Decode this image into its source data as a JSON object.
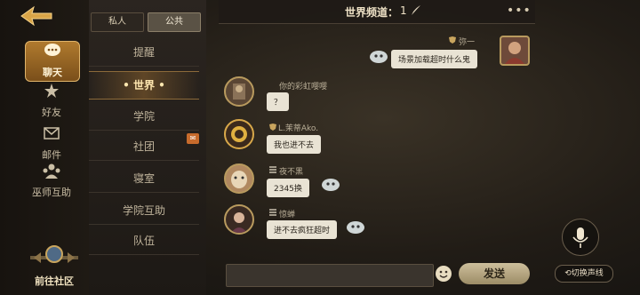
{
  "nav": {
    "items": [
      {
        "label": "聊天"
      },
      {
        "label": "好友"
      },
      {
        "label": "邮件"
      },
      {
        "label": "巫师互助"
      }
    ],
    "community_label": "前往社区"
  },
  "tabs": {
    "private": "私人",
    "public": "公共"
  },
  "channels": [
    {
      "label": "提醒"
    },
    {
      "label": "• 世界 •"
    },
    {
      "label": "学院"
    },
    {
      "label": "社团"
    },
    {
      "label": "寝室"
    },
    {
      "label": "学院互助"
    },
    {
      "label": "队伍"
    }
  ],
  "header": {
    "title": "世界频道：",
    "count": "1",
    "more": "•••"
  },
  "messages": [
    {
      "side": "right",
      "name": "弥一",
      "text": "场景加载超时什么鬼"
    },
    {
      "side": "left",
      "name": "你的彩虹嘤嘤",
      "text": "？"
    },
    {
      "side": "left",
      "name": "L.茉蒂Ako.",
      "text": "我也进不去"
    },
    {
      "side": "left",
      "name": "夜不黑",
      "text": "2345换"
    },
    {
      "side": "left",
      "name": "惊蝉",
      "text": "进不去疯狂超时"
    }
  ],
  "input": {
    "placeholder": "",
    "send_label": "发送",
    "switch_label": "切换声线"
  },
  "colors": {
    "accent": "#b07a2e",
    "bubble": "#e9e3d4",
    "gold": "#e0b46a"
  }
}
